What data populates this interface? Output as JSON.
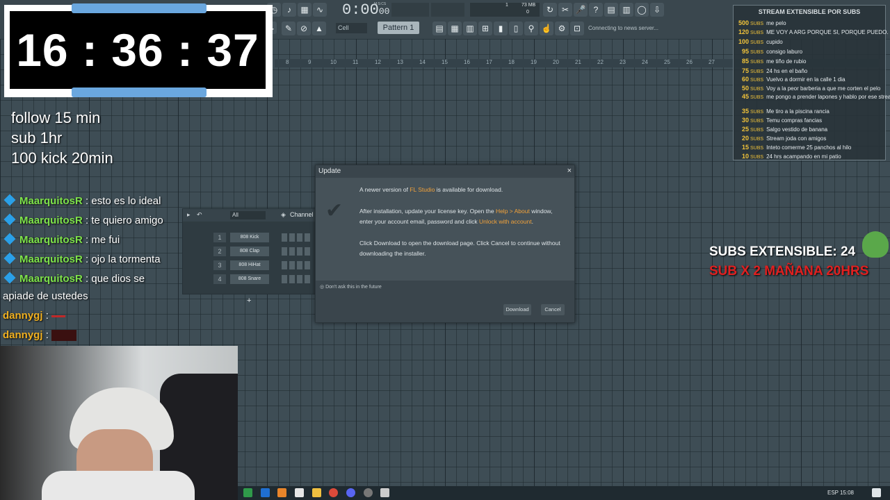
{
  "fl": {
    "time": "0:00",
    "time_small": "00",
    "music_label": "M:S:CS",
    "cpu_value": "1",
    "mem_value": "73 MB",
    "cpu_small": "0",
    "pattern": "Pattern 1",
    "cell": "Cell",
    "news": "Connecting to news server...",
    "ruler": [
      "8",
      "9",
      "10",
      "11",
      "12",
      "13",
      "14",
      "15",
      "16",
      "17",
      "18",
      "19",
      "20",
      "21",
      "22",
      "23",
      "24",
      "25",
      "26",
      "27"
    ]
  },
  "timer": {
    "value": "16 : 36 : 37"
  },
  "rules": [
    "follow 15 min",
    "sub 1hr",
    "100 kick 20min"
  ],
  "chat": [
    {
      "user": "MaarquitosR",
      "msg": ": esto es lo ideal"
    },
    {
      "user": "MaarquitosR",
      "msg": ": te quiero amigo"
    },
    {
      "user": "MaarquitosR",
      "msg": ": me fui"
    },
    {
      "user": "MaarquitosR",
      "msg": ": ojo la tormenta"
    },
    {
      "user": "MaarquitosR",
      "msg": ": que dios se"
    },
    {
      "user": "",
      "msg": "apiade de ustedes"
    },
    {
      "user": "dannygj",
      "msg": ":"
    },
    {
      "user": "dannygj",
      "msg": ":"
    }
  ],
  "rack": {
    "filter": "All",
    "title": "Channel",
    "channels": [
      {
        "num": "1",
        "name": "808 Kick"
      },
      {
        "num": "2",
        "name": "808 Clap"
      },
      {
        "num": "3",
        "name": "808 HiHat"
      },
      {
        "num": "4",
        "name": "808 Snare"
      }
    ],
    "add": "+"
  },
  "dialog": {
    "title": "Update",
    "close": "×",
    "line1_pre": "A newer version of ",
    "line1_link": "FL Studio",
    "line1_post": " is available for download.",
    "line2_pre": "After installation, update your license key. Open the ",
    "line2_link": "Help > About",
    "line2_post": " window,",
    "line3_pre": "enter your account email, password and click ",
    "line3_link": "Unlock with account",
    "line3_post": ".",
    "line4": "Click Download to open the download page. Click Cancel to continue without",
    "line5": "downloading the installer.",
    "dont_ask": "Don't ask this in the future",
    "download": "Download",
    "cancel": "Cancel"
  },
  "subs": {
    "title": "STREAM EXTENSIBLE POR SUBS",
    "label": "SUBS",
    "rows": [
      {
        "n": "500",
        "d": "me pelo"
      },
      {
        "n": "120",
        "d": "ME VOY A ARG PORQUE SI, PORQUE PUEDO."
      },
      {
        "n": "100",
        "d": "cupido"
      },
      {
        "n": "95",
        "d": "consigo laburo"
      },
      {
        "n": "85",
        "d": "me tiño de rubio"
      },
      {
        "n": "75",
        "d": "24 hs en el baño"
      },
      {
        "n": "60",
        "d": "Vuelvo a dormir en la calle 1 dia"
      },
      {
        "n": "50",
        "d": "Voy a la peor barberia a que me corten el pelo"
      },
      {
        "n": "45",
        "d": "me pongo a prender lapones y hablo por ese stream lapones"
      },
      {
        "n": "35",
        "d": "Me tiro a la piscina rancia"
      },
      {
        "n": "30",
        "d": "Temu compras fancias"
      },
      {
        "n": "25",
        "d": "Salgo vestido de banana"
      },
      {
        "n": "20",
        "d": "Stream joda con amigos"
      },
      {
        "n": "15",
        "d": "Inteto comerme 25 panchos al hilo"
      },
      {
        "n": "10",
        "d": "24 hrs acampando en mi patio"
      }
    ]
  },
  "extensible": {
    "line1": "SUBS EXTENSIBLE: 24",
    "line2": "SUB X 2 MAÑANA 20HRS"
  },
  "taskbar": {
    "lang": "ESP",
    "time": "15:08"
  },
  "colors": {
    "timer_accent": "#6aa7df",
    "chat_user": "#7ee34a",
    "subs_gold": "#f1c33a",
    "promo_red": "#e02020",
    "link_orange": "#f2a23a"
  }
}
